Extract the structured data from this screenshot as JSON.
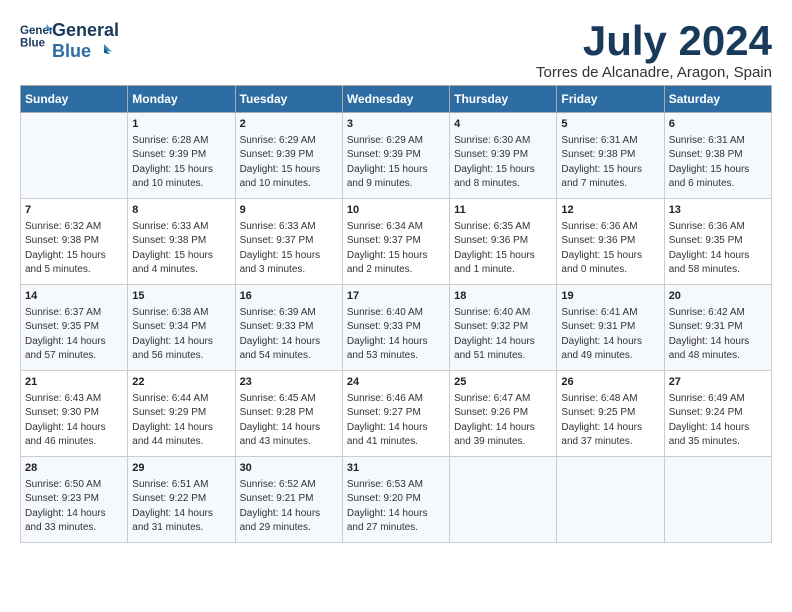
{
  "header": {
    "logo_line1": "General",
    "logo_line2": "Blue",
    "month": "July 2024",
    "location": "Torres de Alcanadre, Aragon, Spain"
  },
  "weekdays": [
    "Sunday",
    "Monday",
    "Tuesday",
    "Wednesday",
    "Thursday",
    "Friday",
    "Saturday"
  ],
  "weeks": [
    [
      {
        "day": "",
        "content": ""
      },
      {
        "day": "1",
        "content": "Sunrise: 6:28 AM\nSunset: 9:39 PM\nDaylight: 15 hours\nand 10 minutes."
      },
      {
        "day": "2",
        "content": "Sunrise: 6:29 AM\nSunset: 9:39 PM\nDaylight: 15 hours\nand 10 minutes."
      },
      {
        "day": "3",
        "content": "Sunrise: 6:29 AM\nSunset: 9:39 PM\nDaylight: 15 hours\nand 9 minutes."
      },
      {
        "day": "4",
        "content": "Sunrise: 6:30 AM\nSunset: 9:39 PM\nDaylight: 15 hours\nand 8 minutes."
      },
      {
        "day": "5",
        "content": "Sunrise: 6:31 AM\nSunset: 9:38 PM\nDaylight: 15 hours\nand 7 minutes."
      },
      {
        "day": "6",
        "content": "Sunrise: 6:31 AM\nSunset: 9:38 PM\nDaylight: 15 hours\nand 6 minutes."
      }
    ],
    [
      {
        "day": "7",
        "content": "Sunrise: 6:32 AM\nSunset: 9:38 PM\nDaylight: 15 hours\nand 5 minutes."
      },
      {
        "day": "8",
        "content": "Sunrise: 6:33 AM\nSunset: 9:38 PM\nDaylight: 15 hours\nand 4 minutes."
      },
      {
        "day": "9",
        "content": "Sunrise: 6:33 AM\nSunset: 9:37 PM\nDaylight: 15 hours\nand 3 minutes."
      },
      {
        "day": "10",
        "content": "Sunrise: 6:34 AM\nSunset: 9:37 PM\nDaylight: 15 hours\nand 2 minutes."
      },
      {
        "day": "11",
        "content": "Sunrise: 6:35 AM\nSunset: 9:36 PM\nDaylight: 15 hours\nand 1 minute."
      },
      {
        "day": "12",
        "content": "Sunrise: 6:36 AM\nSunset: 9:36 PM\nDaylight: 15 hours\nand 0 minutes."
      },
      {
        "day": "13",
        "content": "Sunrise: 6:36 AM\nSunset: 9:35 PM\nDaylight: 14 hours\nand 58 minutes."
      }
    ],
    [
      {
        "day": "14",
        "content": "Sunrise: 6:37 AM\nSunset: 9:35 PM\nDaylight: 14 hours\nand 57 minutes."
      },
      {
        "day": "15",
        "content": "Sunrise: 6:38 AM\nSunset: 9:34 PM\nDaylight: 14 hours\nand 56 minutes."
      },
      {
        "day": "16",
        "content": "Sunrise: 6:39 AM\nSunset: 9:33 PM\nDaylight: 14 hours\nand 54 minutes."
      },
      {
        "day": "17",
        "content": "Sunrise: 6:40 AM\nSunset: 9:33 PM\nDaylight: 14 hours\nand 53 minutes."
      },
      {
        "day": "18",
        "content": "Sunrise: 6:40 AM\nSunset: 9:32 PM\nDaylight: 14 hours\nand 51 minutes."
      },
      {
        "day": "19",
        "content": "Sunrise: 6:41 AM\nSunset: 9:31 PM\nDaylight: 14 hours\nand 49 minutes."
      },
      {
        "day": "20",
        "content": "Sunrise: 6:42 AM\nSunset: 9:31 PM\nDaylight: 14 hours\nand 48 minutes."
      }
    ],
    [
      {
        "day": "21",
        "content": "Sunrise: 6:43 AM\nSunset: 9:30 PM\nDaylight: 14 hours\nand 46 minutes."
      },
      {
        "day": "22",
        "content": "Sunrise: 6:44 AM\nSunset: 9:29 PM\nDaylight: 14 hours\nand 44 minutes."
      },
      {
        "day": "23",
        "content": "Sunrise: 6:45 AM\nSunset: 9:28 PM\nDaylight: 14 hours\nand 43 minutes."
      },
      {
        "day": "24",
        "content": "Sunrise: 6:46 AM\nSunset: 9:27 PM\nDaylight: 14 hours\nand 41 minutes."
      },
      {
        "day": "25",
        "content": "Sunrise: 6:47 AM\nSunset: 9:26 PM\nDaylight: 14 hours\nand 39 minutes."
      },
      {
        "day": "26",
        "content": "Sunrise: 6:48 AM\nSunset: 9:25 PM\nDaylight: 14 hours\nand 37 minutes."
      },
      {
        "day": "27",
        "content": "Sunrise: 6:49 AM\nSunset: 9:24 PM\nDaylight: 14 hours\nand 35 minutes."
      }
    ],
    [
      {
        "day": "28",
        "content": "Sunrise: 6:50 AM\nSunset: 9:23 PM\nDaylight: 14 hours\nand 33 minutes."
      },
      {
        "day": "29",
        "content": "Sunrise: 6:51 AM\nSunset: 9:22 PM\nDaylight: 14 hours\nand 31 minutes."
      },
      {
        "day": "30",
        "content": "Sunrise: 6:52 AM\nSunset: 9:21 PM\nDaylight: 14 hours\nand 29 minutes."
      },
      {
        "day": "31",
        "content": "Sunrise: 6:53 AM\nSunset: 9:20 PM\nDaylight: 14 hours\nand 27 minutes."
      },
      {
        "day": "",
        "content": ""
      },
      {
        "day": "",
        "content": ""
      },
      {
        "day": "",
        "content": ""
      }
    ]
  ]
}
